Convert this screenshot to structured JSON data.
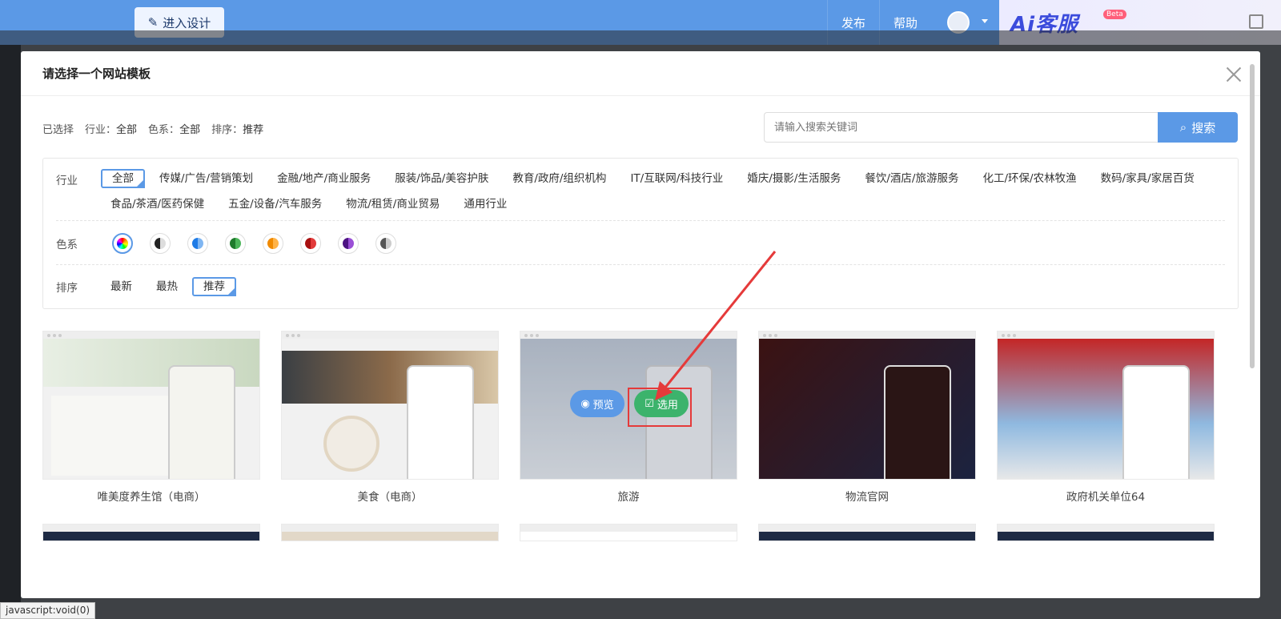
{
  "topbar": {
    "design_button": "进入设计",
    "nav": [
      "发布",
      "帮助"
    ],
    "ai_logo": "Ai客服",
    "ai_badge": "Beta"
  },
  "modal": {
    "title": "请选择一个网站模板",
    "selected": {
      "prefix": "已选择",
      "industry_label": "行业：",
      "industry_value": "全部",
      "color_label": "色系：",
      "color_value": "全部",
      "sort_label": "排序：",
      "sort_value": "推荐"
    },
    "search": {
      "placeholder": "请输入搜索关键词",
      "button": "搜索"
    },
    "filters": {
      "industry_label": "行业",
      "industries": [
        "全部",
        "传媒/广告/营销策划",
        "金融/地产/商业服务",
        "服装/饰品/美容护肤",
        "教育/政府/组织机构",
        "IT/互联网/科技行业",
        "婚庆/摄影/生活服务",
        "餐饮/酒店/旅游服务",
        "化工/环保/农林牧渔",
        "数码/家具/家居百货",
        "食品/茶酒/医药保健",
        "五金/设备/汽车服务",
        "物流/租赁/商业贸易",
        "通用行业"
      ],
      "color_label": "色系",
      "colors": [
        "#multicolor",
        "#222222",
        "#1e7be6",
        "#2c9a3a",
        "#f59a1a",
        "#d01c1c",
        "#6a1fa8",
        "#777777"
      ],
      "sort_label": "排序",
      "sorts": [
        "最新",
        "最热",
        "推荐"
      ]
    },
    "templates": [
      {
        "title": "唯美度养生馆（电商）"
      },
      {
        "title": "美食（电商）"
      },
      {
        "title": "旅游",
        "preview": "预览",
        "select": "选用"
      },
      {
        "title": "物流官网"
      },
      {
        "title": "政府机关单位64"
      }
    ]
  },
  "statusbar": {
    "text": "javascript:void(0)"
  }
}
